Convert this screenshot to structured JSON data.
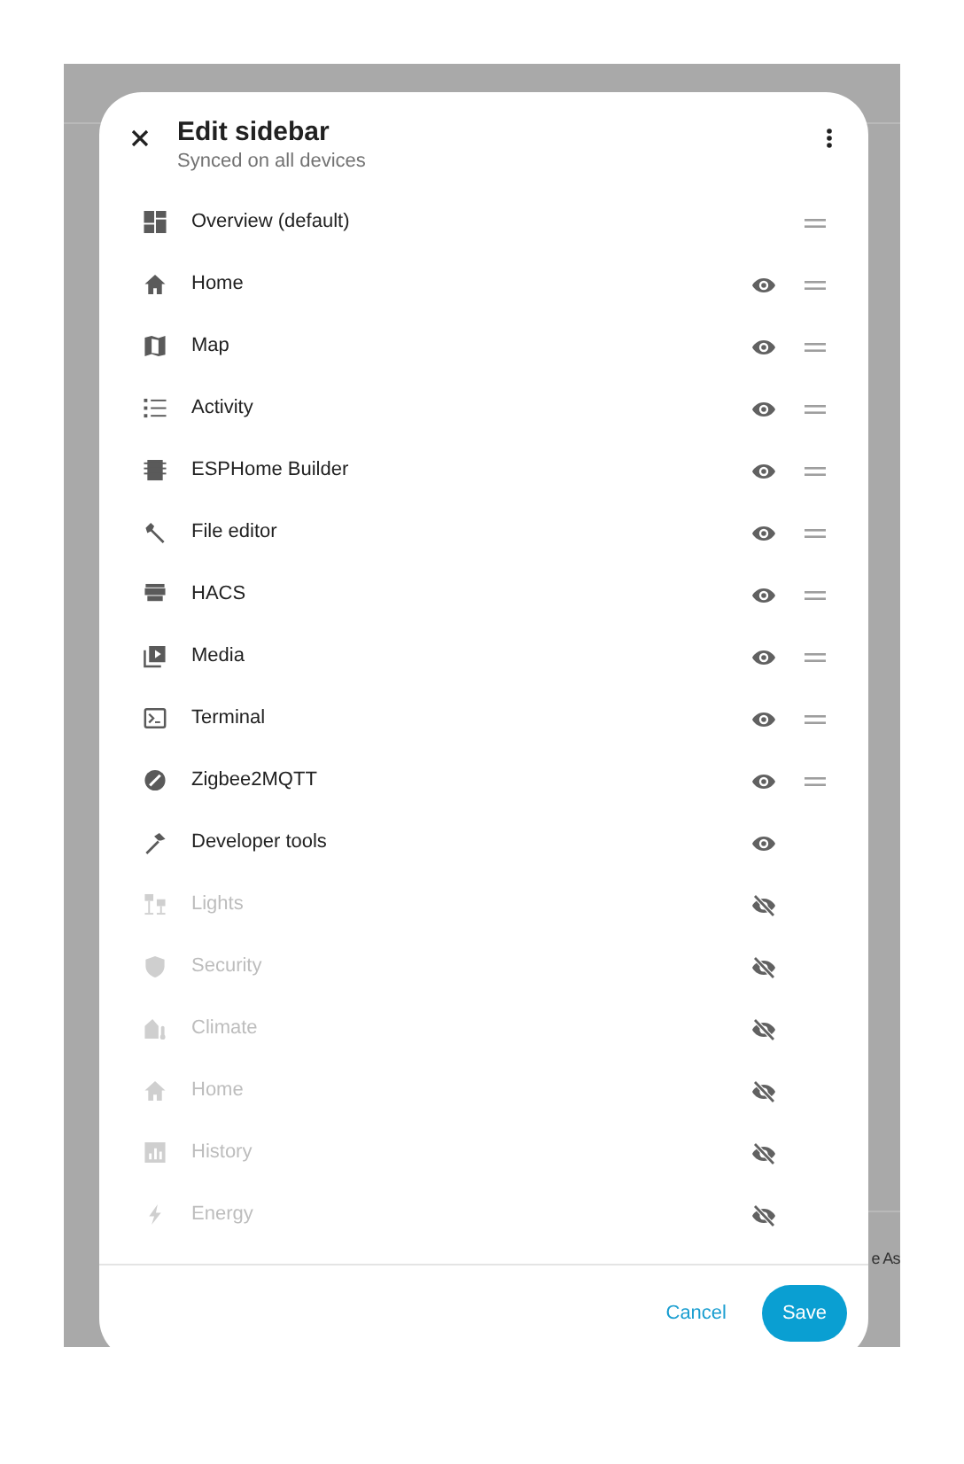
{
  "background": {
    "text": "e As"
  },
  "dialog": {
    "title": "Edit sidebar",
    "subtitle": "Synced on all devices",
    "items": [
      {
        "label": "Overview (default)",
        "kind": "default",
        "hidden": false,
        "reorderable": true
      },
      {
        "label": "Home",
        "kind": "toggle",
        "hidden": false,
        "reorderable": true
      },
      {
        "label": "Map",
        "kind": "toggle",
        "hidden": false,
        "reorderable": true
      },
      {
        "label": "Activity",
        "kind": "toggle",
        "hidden": false,
        "reorderable": true
      },
      {
        "label": "ESPHome Builder",
        "kind": "toggle",
        "hidden": false,
        "reorderable": true
      },
      {
        "label": "File editor",
        "kind": "toggle",
        "hidden": false,
        "reorderable": true
      },
      {
        "label": "HACS",
        "kind": "toggle",
        "hidden": false,
        "reorderable": true
      },
      {
        "label": "Media",
        "kind": "toggle",
        "hidden": false,
        "reorderable": true
      },
      {
        "label": "Terminal",
        "kind": "toggle",
        "hidden": false,
        "reorderable": true
      },
      {
        "label": "Zigbee2MQTT",
        "kind": "toggle",
        "hidden": false,
        "reorderable": true
      },
      {
        "label": "Developer tools",
        "kind": "toggle",
        "hidden": false,
        "reorderable": false
      },
      {
        "label": "Lights",
        "kind": "toggle",
        "hidden": true,
        "reorderable": false
      },
      {
        "label": "Security",
        "kind": "toggle",
        "hidden": true,
        "reorderable": false
      },
      {
        "label": "Climate",
        "kind": "toggle",
        "hidden": true,
        "reorderable": false
      },
      {
        "label": "Home",
        "kind": "toggle",
        "hidden": true,
        "reorderable": false
      },
      {
        "label": "History",
        "kind": "toggle",
        "hidden": true,
        "reorderable": false
      },
      {
        "label": "Energy",
        "kind": "toggle",
        "hidden": true,
        "reorderable": false
      }
    ],
    "buttons": [
      {
        "label": "Cancel",
        "kind": "text"
      },
      {
        "label": "Save",
        "kind": "primary"
      }
    ]
  }
}
